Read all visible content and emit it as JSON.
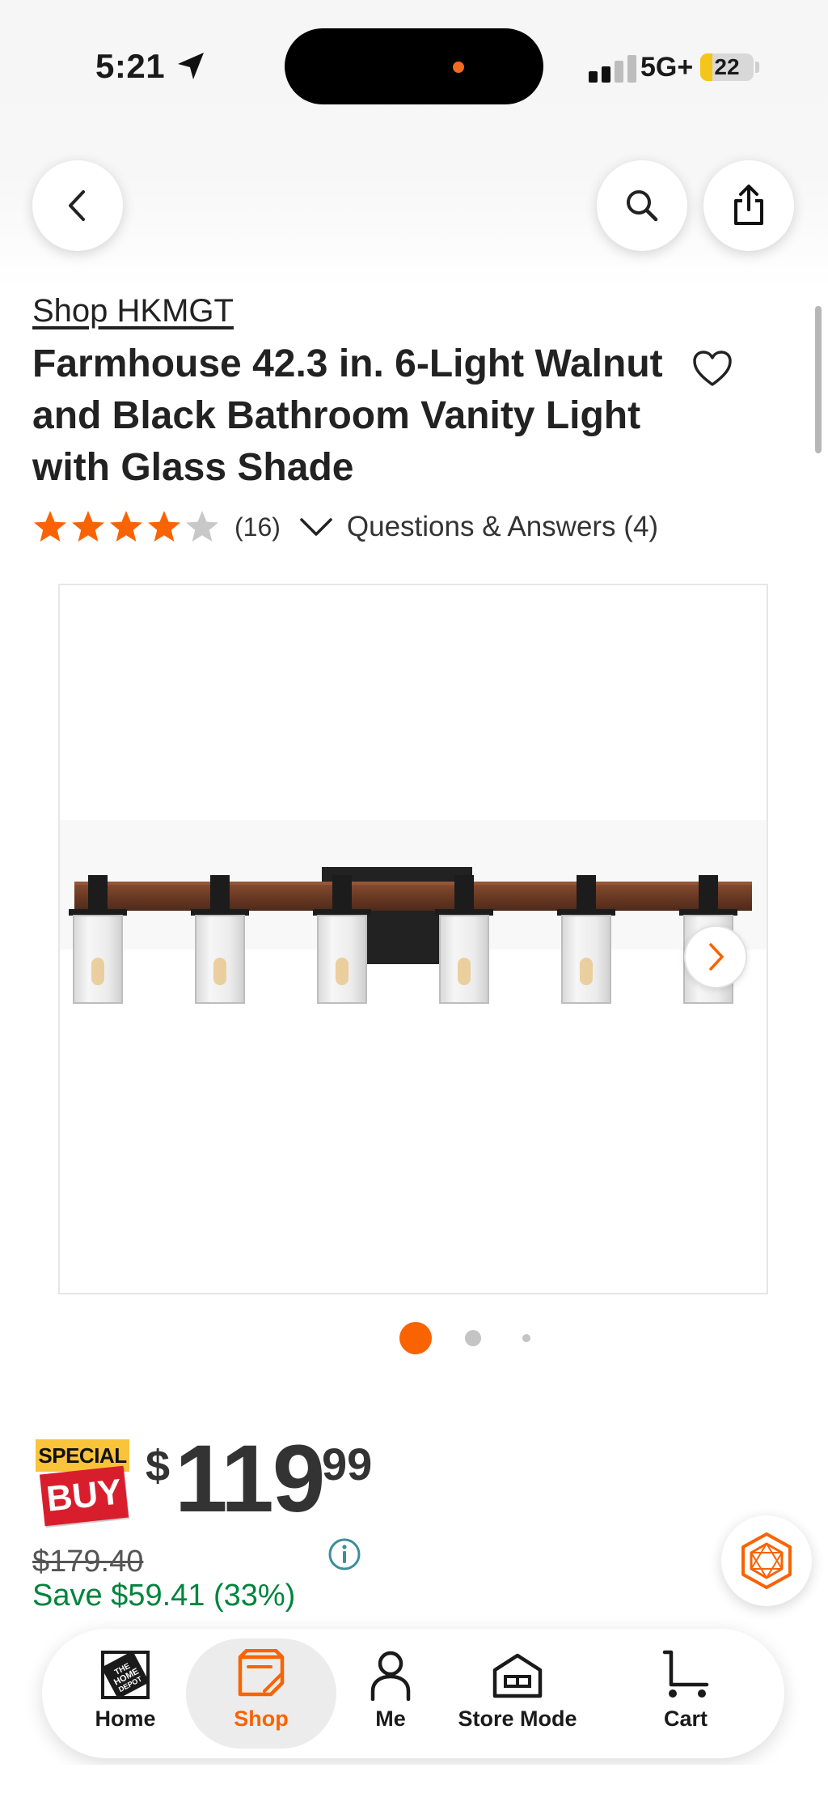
{
  "status_bar": {
    "time": "5:21",
    "network": "5G+",
    "battery_percent": "22",
    "signal_bars_active": 2,
    "signal_bars_total": 4
  },
  "nav": {
    "back_icon": "chevron-left-icon",
    "search_icon": "search-icon",
    "share_icon": "share-icon"
  },
  "product": {
    "brand_link": "Shop HKMGT",
    "title": "Farmhouse 42.3 in. 6-Light Walnut and Black Bathroom Vanity Light with Glass Shade",
    "rating_value": 4,
    "rating_max": 5,
    "rating_count": "(16)",
    "qa_link": "Questions & Answers (4)"
  },
  "gallery": {
    "active_index": 0,
    "image_count": 3,
    "next_icon": "chevron-right-icon"
  },
  "pricing": {
    "badge_top": "SPECIAL",
    "badge_bottom": "BUY",
    "currency": "$",
    "price_dollars": "119",
    "price_cents": "99",
    "was_price": "$179.40",
    "savings": "Save $59.41 (33%)"
  },
  "tabbar": {
    "items": [
      {
        "label": "Home",
        "icon": "home-depot-logo"
      },
      {
        "label": "Shop",
        "icon": "shop-tag-icon",
        "active": true
      },
      {
        "label": "Me",
        "icon": "user-icon"
      },
      {
        "label": "Store Mode",
        "icon": "store-icon"
      },
      {
        "label": "Cart",
        "icon": "cart-icon"
      }
    ]
  },
  "colors": {
    "brand_orange": "#f96302",
    "savings_green": "#00843d",
    "badge_yellow": "#f9c33a",
    "badge_red": "#d81e2c",
    "info_teal": "#3a8f9a"
  }
}
